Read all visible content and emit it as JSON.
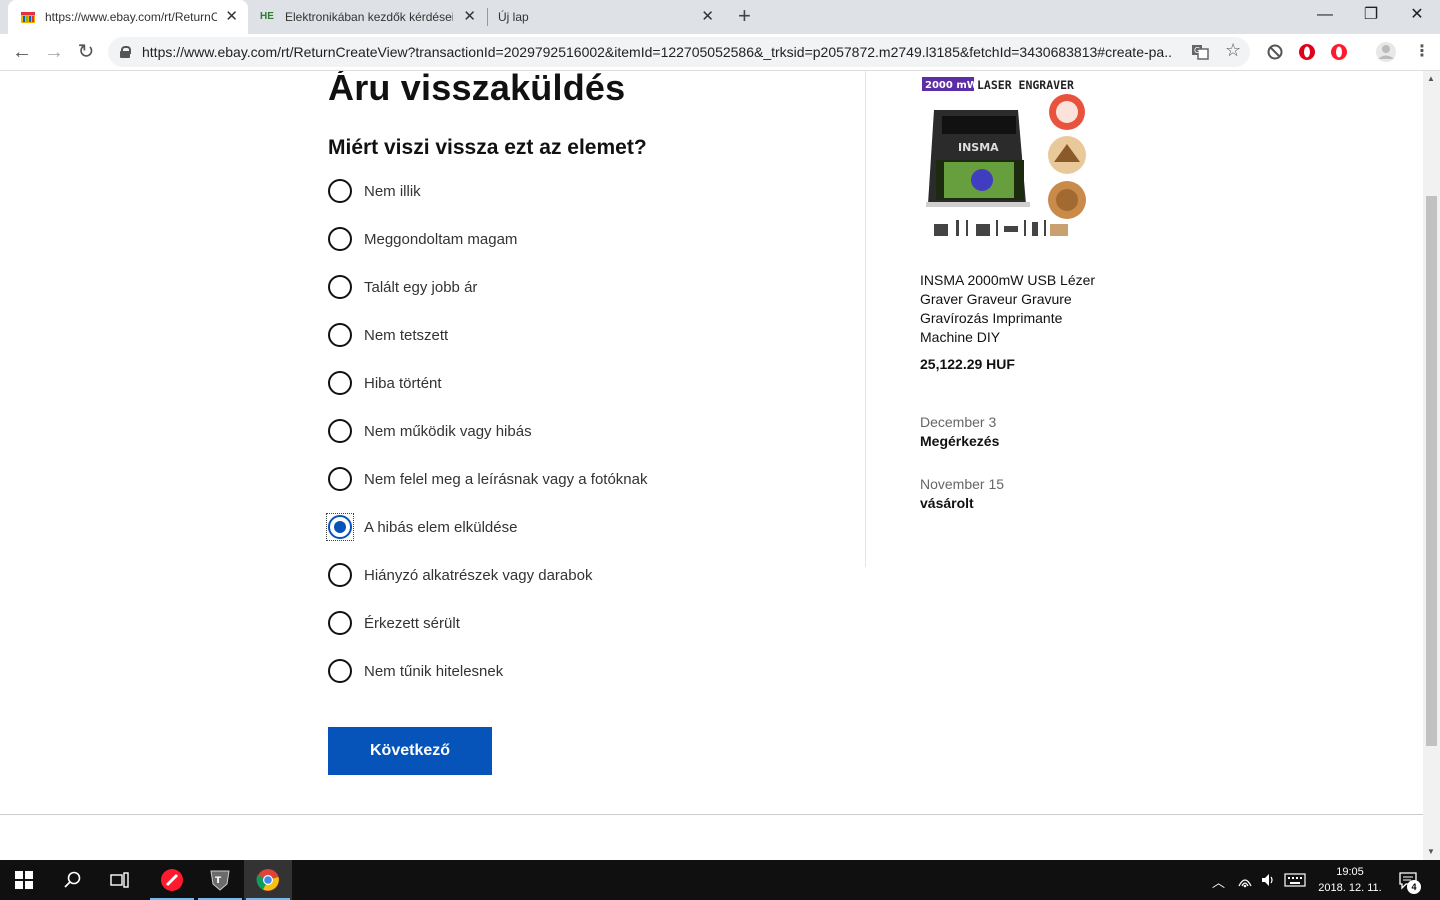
{
  "browser": {
    "tabs": [
      {
        "title": "https://www.ebay.com/rt/ReturnC",
        "active": true,
        "favicon": "ebay-favicon"
      },
      {
        "title": "Elektronikában kezdők kérdései -",
        "active": false,
        "favicon": "he-favicon",
        "favicon_text": "HE"
      },
      {
        "title": "Új lap",
        "active": false,
        "favicon": "none"
      }
    ],
    "new_tab_glyph": "+",
    "window_controls": {
      "minimize": "—",
      "restore": "❐",
      "close": "✕"
    },
    "url": "https://www.ebay.com/rt/ReturnCreateView?transactionId=2029792516002&itemId=122705052586&_trksid=p2057872.m2749.l3185&fetchId=3430683813#create-pa...",
    "icons": [
      "back-icon",
      "forward-icon",
      "reload-icon",
      "lock-icon",
      "translate-icon",
      "star-icon",
      "block-icon",
      "opera-icon",
      "opera-red-icon",
      "profile-icon",
      "menu-icon"
    ]
  },
  "page": {
    "title": "Áru visszaküldés",
    "question": "Miért viszi vissza ezt az elemet?",
    "reasons": [
      {
        "label": "Nem illik",
        "checked": false
      },
      {
        "label": "Meggondoltam magam",
        "checked": false
      },
      {
        "label": "Talált egy jobb ár",
        "checked": false
      },
      {
        "label": "Nem tetszett",
        "checked": false
      },
      {
        "label": "Hiba történt",
        "checked": false
      },
      {
        "label": "Nem működik vagy hibás",
        "checked": false
      },
      {
        "label": "Nem felel meg a leírásnak vagy a fotóknak",
        "checked": false
      },
      {
        "label": "A hibás elem elküldése",
        "checked": true
      },
      {
        "label": "Hiányzó alkatrészek vagy darabok",
        "checked": false
      },
      {
        "label": "Érkezett sérült",
        "checked": false
      },
      {
        "label": "Nem tűnik hitelesnek",
        "checked": false
      }
    ],
    "next_button": "Következő",
    "accent_color": "#0654ba"
  },
  "product": {
    "image_banner_badge": "2000 mW",
    "image_banner_text": "LASER ENGRAVER",
    "image_device_label": "INSMA",
    "title": "INSMA 2000mW USB Lézer Graver Graveur Gravure Gravírozás Imprimante Machine DIY",
    "price": "25,122.29 HUF",
    "events": [
      {
        "date": "December 3",
        "label": "Megérkezés"
      },
      {
        "date": "November 15",
        "label": "vásárolt"
      }
    ]
  },
  "taskbar": {
    "apps": [
      "start-icon",
      "search-icon",
      "task-view-icon",
      "opera-app-icon",
      "world-of-tanks-icon",
      "chrome-icon"
    ],
    "clock_time": "19:05",
    "clock_date": "2018. 12. 11.",
    "notification_count": "4"
  }
}
